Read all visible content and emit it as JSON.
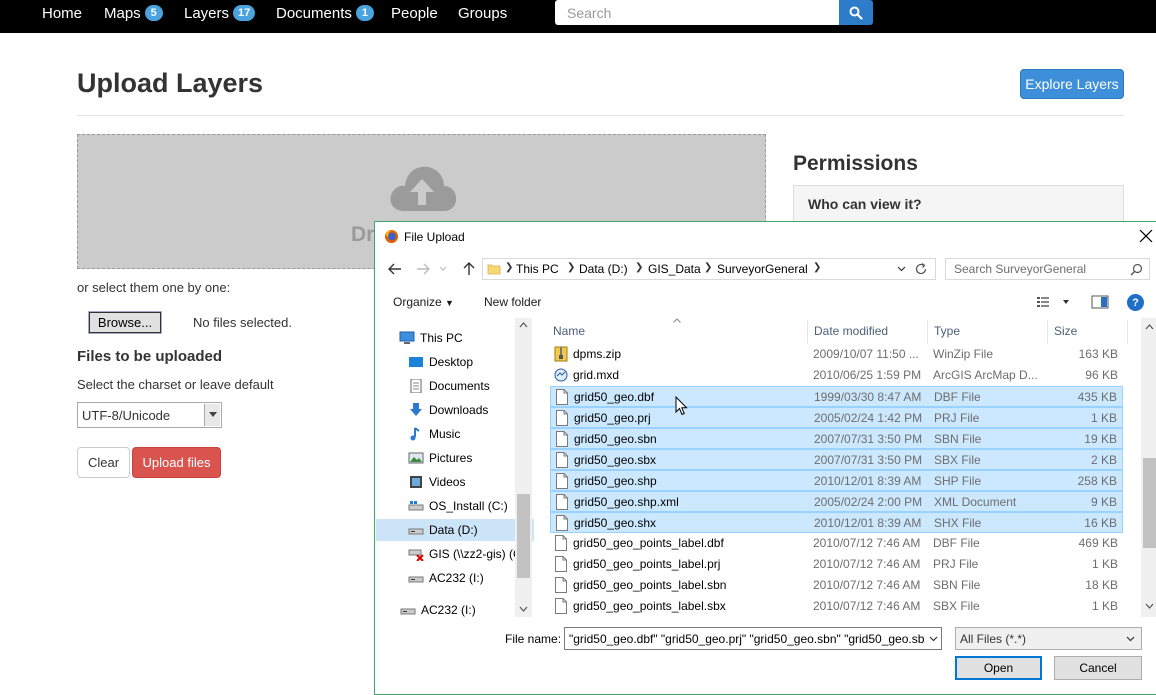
{
  "navbar": {
    "items": [
      {
        "label": "Home"
      },
      {
        "label": "Maps",
        "badge": "5"
      },
      {
        "label": "Layers",
        "badge": "17"
      },
      {
        "label": "Documents",
        "badge": "1"
      },
      {
        "label": "People"
      },
      {
        "label": "Groups"
      }
    ],
    "search_placeholder": "Search"
  },
  "page": {
    "title": "Upload Layers",
    "explore_button": "Explore Layers",
    "drop_text": "Dr",
    "select_one": "or select them one by one:",
    "browse_button": "Browse...",
    "no_files": "No files selected.",
    "files_heading": "Files to be uploaded",
    "charset_label": "Select the charset or leave default",
    "charset_value": "UTF-8/Unicode",
    "clear_button": "Clear",
    "upload_button": "Upload files",
    "permissions_title": "Permissions",
    "who_can_view": "Who can view it?"
  },
  "dialog": {
    "title": "File Upload",
    "breadcrumb": [
      "This PC",
      "Data (D:)",
      "GIS_Data",
      "SurveyorGeneral"
    ],
    "search_placeholder": "Search SurveyorGeneral",
    "organize": "Organize",
    "new_folder": "New folder",
    "tree": [
      {
        "label": "This PC",
        "icon": "pc-icon"
      },
      {
        "label": "Desktop",
        "icon": "desktop-icon"
      },
      {
        "label": "Documents",
        "icon": "documents-icon"
      },
      {
        "label": "Downloads",
        "icon": "downloads-icon"
      },
      {
        "label": "Music",
        "icon": "music-icon"
      },
      {
        "label": "Pictures",
        "icon": "pictures-icon"
      },
      {
        "label": "Videos",
        "icon": "videos-icon"
      },
      {
        "label": "OS_Install (C:)",
        "icon": "drive-c-icon"
      },
      {
        "label": "Data (D:)",
        "icon": "drive-icon",
        "selected": true
      },
      {
        "label": "GIS (\\\\zz2-gis) (G",
        "icon": "network-drive-icon"
      },
      {
        "label": "AC232 (I:)",
        "icon": "drive-icon"
      },
      {
        "label": "AC232 (I:)",
        "icon": "drive-icon"
      }
    ],
    "columns": {
      "name": "Name",
      "date": "Date modified",
      "type": "Type",
      "size": "Size"
    },
    "files": [
      {
        "name": "dpms.zip",
        "date": "2009/10/07 11:50 ...",
        "type": "WinZip File",
        "size": "163 KB",
        "selected": false,
        "icon": "zip-icon"
      },
      {
        "name": "grid.mxd",
        "date": "2010/06/25 1:59 PM",
        "type": "ArcGIS ArcMap D...",
        "size": "96 KB",
        "selected": false,
        "icon": "arcmap-icon"
      },
      {
        "name": "grid50_geo.dbf",
        "date": "1999/03/30 8:47 AM",
        "type": "DBF File",
        "size": "435 KB",
        "selected": true,
        "icon": "file-icon"
      },
      {
        "name": "grid50_geo.prj",
        "date": "2005/02/24 1:42 PM",
        "type": "PRJ File",
        "size": "1 KB",
        "selected": true,
        "icon": "file-icon"
      },
      {
        "name": "grid50_geo.sbn",
        "date": "2007/07/31 3:50 PM",
        "type": "SBN File",
        "size": "19 KB",
        "selected": true,
        "icon": "file-icon"
      },
      {
        "name": "grid50_geo.sbx",
        "date": "2007/07/31 3:50 PM",
        "type": "SBX File",
        "size": "2 KB",
        "selected": true,
        "icon": "file-icon"
      },
      {
        "name": "grid50_geo.shp",
        "date": "2010/12/01 8:39 AM",
        "type": "SHP File",
        "size": "258 KB",
        "selected": true,
        "icon": "file-icon"
      },
      {
        "name": "grid50_geo.shp.xml",
        "date": "2005/02/24 2:00 PM",
        "type": "XML Document",
        "size": "9 KB",
        "selected": true,
        "icon": "file-icon"
      },
      {
        "name": "grid50_geo.shx",
        "date": "2010/12/01 8:39 AM",
        "type": "SHX File",
        "size": "16 KB",
        "selected": true,
        "icon": "file-icon"
      },
      {
        "name": "grid50_geo_points_label.dbf",
        "date": "2010/07/12 7:46 AM",
        "type": "DBF File",
        "size": "469 KB",
        "selected": false,
        "icon": "file-icon"
      },
      {
        "name": "grid50_geo_points_label.prj",
        "date": "2010/07/12 7:46 AM",
        "type": "PRJ File",
        "size": "1 KB",
        "selected": false,
        "icon": "file-icon"
      },
      {
        "name": "grid50_geo_points_label.sbn",
        "date": "2010/07/12 7:46 AM",
        "type": "SBN File",
        "size": "18 KB",
        "selected": false,
        "icon": "file-icon"
      },
      {
        "name": "grid50_geo_points_label.sbx",
        "date": "2010/07/12 7:46 AM",
        "type": "SBX File",
        "size": "1 KB",
        "selected": false,
        "icon": "file-icon"
      }
    ],
    "file_name_label": "File name:",
    "file_name_value": "\"grid50_geo.dbf\" \"grid50_geo.prj\" \"grid50_geo.sbn\" \"grid50_geo.sbx",
    "filter_value": "All Files (*.*)",
    "open_button": "Open",
    "cancel_button": "Cancel"
  },
  "colors": {
    "navbar_bg": "#000000",
    "badge": "#4aa3df",
    "primary": "#3c8fd8",
    "danger": "#d9534f",
    "selection": "#cce8ff"
  }
}
